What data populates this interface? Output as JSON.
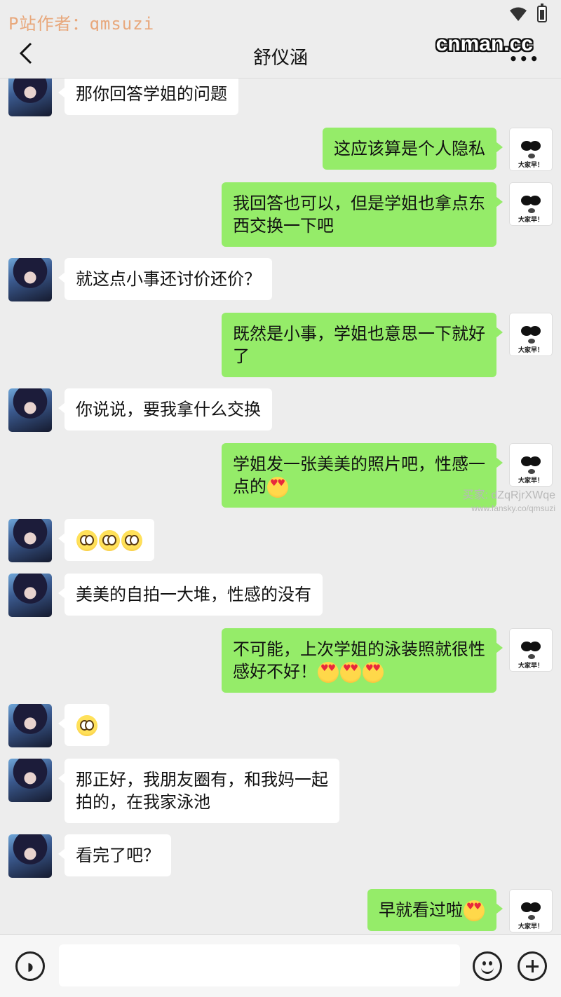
{
  "status_bar": {
    "watermark": "P站作者：qmsuzi"
  },
  "header": {
    "title": "舒仪涵",
    "brand_watermark": "cnman.cc",
    "more_label": "•••"
  },
  "contact_avatar_caption": "大家早！",
  "messages": [
    {
      "from": "her",
      "text": "那你回答学姐的问题"
    },
    {
      "from": "me",
      "text": "这应该算是个人隐私"
    },
    {
      "from": "me",
      "text": "我回答也可以，但是学姐也拿点东",
      "text2": "西交换一下吧"
    },
    {
      "from": "her",
      "text": "就这点小事还讨价还价？"
    },
    {
      "from": "me",
      "text": "既然是小事，学姐也意思一下就好",
      "text2": "了"
    },
    {
      "from": "her",
      "text": "你说说，要我拿什么交换"
    },
    {
      "from": "me",
      "text": "学姐发一张美美的照片吧，性感一",
      "text2": "点的",
      "emoji": "heart-eyes"
    },
    {
      "from": "her",
      "emoji": "flushed x3"
    },
    {
      "from": "her",
      "text": "美美的自拍一大堆，性感的没有"
    },
    {
      "from": "me",
      "text": "不可能，上次学姐的泳装照就很性",
      "text2": "感好不好！",
      "emoji": "heart-eyes x3"
    },
    {
      "from": "her",
      "emoji": "flushed"
    },
    {
      "from": "her",
      "text": "那正好，我朋友圈有，和我妈一起",
      "text2": "拍的，在我家泳池"
    },
    {
      "from": "her",
      "text": "看完了吧？"
    },
    {
      "from": "me",
      "text": "早就看过啦",
      "emoji": "heart-eyes"
    }
  ],
  "side_watermark": {
    "line1": "买家: dZqRjrXWqe",
    "line2": "www.fansky.co/qmsuzi"
  },
  "colors": {
    "background": "#ededed",
    "outgoing_bubble": "#95ec69",
    "incoming_bubble": "#ffffff"
  }
}
